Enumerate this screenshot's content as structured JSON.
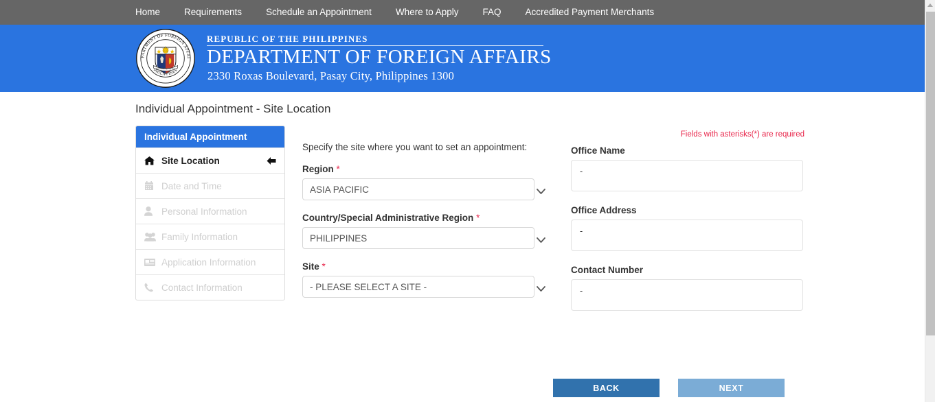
{
  "topnav": {
    "items": [
      {
        "label": "Home",
        "name": "nav-home"
      },
      {
        "label": "Requirements",
        "name": "nav-requirements"
      },
      {
        "label": "Schedule an Appointment",
        "name": "nav-schedule"
      },
      {
        "label": "Where to Apply",
        "name": "nav-where-to-apply"
      },
      {
        "label": "FAQ",
        "name": "nav-faq"
      },
      {
        "label": "Accredited Payment Merchants",
        "name": "nav-merchants"
      }
    ]
  },
  "banner": {
    "republic": "REPUBLIC OF THE PHILIPPINES",
    "department": "DEPARTMENT OF FOREIGN AFFAIRS",
    "address": "2330 Roxas Boulevard, Pasay City, Philippines 1300",
    "seal_outer_text": "DEPARTMENT OF FOREIGN AFFAIRS",
    "seal_bottom_text": "PHILIPPINES",
    "background_color": "#2a74e0"
  },
  "page": {
    "title": "Individual Appointment - Site Location"
  },
  "wizard": {
    "header": "Individual Appointment",
    "items": [
      {
        "label": "Site Location",
        "icon": "home-icon",
        "state": "active"
      },
      {
        "label": "Date and Time",
        "icon": "calendar-icon",
        "state": "disabled"
      },
      {
        "label": "Personal Information",
        "icon": "user-icon",
        "state": "disabled"
      },
      {
        "label": "Family Information",
        "icon": "users-icon",
        "state": "disabled"
      },
      {
        "label": "Application Information",
        "icon": "newspaper-icon",
        "state": "disabled"
      },
      {
        "label": "Contact Information",
        "icon": "phone-icon",
        "state": "disabled"
      }
    ]
  },
  "form": {
    "instruction": "Specify the site where you want to set an appointment:",
    "fields": [
      {
        "label": "Region",
        "required_marker": "*",
        "value": "ASIA PACIFIC",
        "options": [
          "ASIA PACIFIC"
        ]
      },
      {
        "label": "Country/Special Administrative Region",
        "required_marker": "*",
        "value": "PHILIPPINES",
        "options": [
          "PHILIPPINES"
        ]
      },
      {
        "label": "Site",
        "required_marker": "*",
        "value": "- PLEASE SELECT A SITE -",
        "options": [
          "- PLEASE SELECT A SITE -"
        ]
      }
    ]
  },
  "info": {
    "required_note": "Fields with asterisks(*) are required",
    "required_note_color": "#e8254a",
    "fields": [
      {
        "label": "Office Name",
        "value": "-"
      },
      {
        "label": "Office Address",
        "value": "-"
      },
      {
        "label": "Contact Number",
        "value": "-"
      }
    ]
  },
  "buttons": {
    "back": "BACK",
    "next": "NEXT",
    "back_color": "#3172ad",
    "next_color": "#7bacd6"
  }
}
